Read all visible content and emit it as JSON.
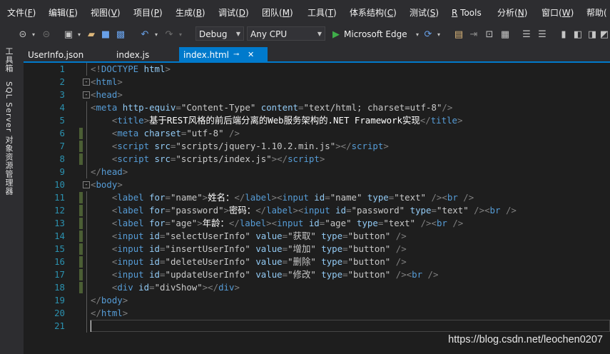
{
  "menu": [
    {
      "label": "文件(",
      "key": "F",
      "tail": ")"
    },
    {
      "label": "编辑(",
      "key": "E",
      "tail": ")"
    },
    {
      "label": "视图(",
      "key": "V",
      "tail": ")"
    },
    {
      "label": "项目(",
      "key": "P",
      "tail": ")"
    },
    {
      "label": "生成(",
      "key": "B",
      "tail": ")"
    },
    {
      "label": "调试(",
      "key": "D",
      "tail": ")"
    },
    {
      "label": "团队(",
      "key": "M",
      "tail": ")"
    },
    {
      "label": "工具(",
      "key": "T",
      "tail": ")"
    },
    {
      "label": "体系结构(",
      "key": "C",
      "tail": ")"
    },
    {
      "label": "测试(",
      "key": "S",
      "tail": ")"
    },
    {
      "label": "",
      "key": "R",
      "tail": " Tools"
    },
    {
      "label": "分析(",
      "key": "N",
      "tail": ")"
    },
    {
      "label": "窗口(",
      "key": "W",
      "tail": ")"
    },
    {
      "label": "帮助(",
      "key": "",
      "tail": ""
    }
  ],
  "toolbar": {
    "config": "Debug",
    "platform": "Any CPU",
    "run_target": "Microsoft Edge"
  },
  "side_tabs": [
    "工具箱",
    "SQL Server 对象资源管理器"
  ],
  "tabs": [
    {
      "label": "UserInfo.json",
      "active": false
    },
    {
      "label": "index.js",
      "active": false
    },
    {
      "label": "index.html",
      "active": true
    }
  ],
  "code_lines": [
    {
      "n": "1",
      "mod": false,
      "fold": "",
      "indent": "",
      "tokens": [
        [
          "b",
          "<!"
        ],
        [
          "t",
          "DOCTYPE"
        ],
        [
          "x",
          " "
        ],
        [
          "a",
          "html"
        ],
        [
          "b",
          ">"
        ]
      ]
    },
    {
      "n": "2",
      "mod": false,
      "fold": "-",
      "indent": "",
      "tokens": [
        [
          "b",
          "<"
        ],
        [
          "t",
          "html"
        ],
        [
          "b",
          ">"
        ]
      ]
    },
    {
      "n": "3",
      "mod": false,
      "fold": "-",
      "indent": "",
      "tokens": [
        [
          "b",
          "<"
        ],
        [
          "t",
          "head"
        ],
        [
          "b",
          ">"
        ]
      ]
    },
    {
      "n": "4",
      "mod": false,
      "fold": "",
      "indent": "",
      "tokens": [
        [
          "b",
          "<"
        ],
        [
          "t",
          "meta"
        ],
        [
          "x",
          " "
        ],
        [
          "a",
          "http-equiv"
        ],
        [
          "b",
          "="
        ],
        [
          "v",
          "\"Content-Type\""
        ],
        [
          "x",
          " "
        ],
        [
          "a",
          "content"
        ],
        [
          "b",
          "="
        ],
        [
          "v",
          "\"text/html; charset=utf-8\""
        ],
        [
          "b",
          "/>"
        ]
      ]
    },
    {
      "n": "5",
      "mod": false,
      "fold": "",
      "indent": "    ",
      "tokens": [
        [
          "b",
          "<"
        ],
        [
          "t",
          "title"
        ],
        [
          "b",
          ">"
        ],
        [
          "x",
          "基于REST风格的前后端分离的Web服务架构的.NET Framework实现"
        ],
        [
          "b",
          "</"
        ],
        [
          "t",
          "title"
        ],
        [
          "b",
          ">"
        ]
      ]
    },
    {
      "n": "6",
      "mod": true,
      "fold": "",
      "indent": "    ",
      "tokens": [
        [
          "b",
          "<"
        ],
        [
          "t",
          "meta"
        ],
        [
          "x",
          " "
        ],
        [
          "a",
          "charset"
        ],
        [
          "b",
          "="
        ],
        [
          "v",
          "\"utf-8\""
        ],
        [
          "x",
          " "
        ],
        [
          "b",
          "/>"
        ]
      ]
    },
    {
      "n": "7",
      "mod": true,
      "fold": "",
      "indent": "    ",
      "tokens": [
        [
          "b",
          "<"
        ],
        [
          "t",
          "script"
        ],
        [
          "x",
          " "
        ],
        [
          "a",
          "src"
        ],
        [
          "b",
          "="
        ],
        [
          "v",
          "\"scripts/jquery-1.10.2.min.js\""
        ],
        [
          "b",
          "></"
        ],
        [
          "t",
          "script"
        ],
        [
          "b",
          ">"
        ]
      ]
    },
    {
      "n": "8",
      "mod": true,
      "fold": "",
      "indent": "    ",
      "tokens": [
        [
          "b",
          "<"
        ],
        [
          "t",
          "script"
        ],
        [
          "x",
          " "
        ],
        [
          "a",
          "src"
        ],
        [
          "b",
          "="
        ],
        [
          "v",
          "\"scripts/index.js\""
        ],
        [
          "b",
          "></"
        ],
        [
          "t",
          "script"
        ],
        [
          "b",
          ">"
        ]
      ]
    },
    {
      "n": "9",
      "mod": false,
      "fold": "",
      "indent": "",
      "tokens": [
        [
          "b",
          "</"
        ],
        [
          "t",
          "head"
        ],
        [
          "b",
          ">"
        ]
      ]
    },
    {
      "n": "10",
      "mod": false,
      "fold": "-",
      "indent": "",
      "tokens": [
        [
          "b",
          "<"
        ],
        [
          "t",
          "body"
        ],
        [
          "b",
          ">"
        ]
      ]
    },
    {
      "n": "11",
      "mod": true,
      "fold": "",
      "indent": "    ",
      "tokens": [
        [
          "b",
          "<"
        ],
        [
          "t",
          "label"
        ],
        [
          "x",
          " "
        ],
        [
          "a",
          "for"
        ],
        [
          "b",
          "="
        ],
        [
          "v",
          "\"name\""
        ],
        [
          "b",
          ">"
        ],
        [
          "x",
          "姓名："
        ],
        [
          "b",
          "</"
        ],
        [
          "t",
          "label"
        ],
        [
          "b",
          "><"
        ],
        [
          "t",
          "input"
        ],
        [
          "x",
          " "
        ],
        [
          "a",
          "id"
        ],
        [
          "b",
          "="
        ],
        [
          "v",
          "\"name\""
        ],
        [
          "x",
          " "
        ],
        [
          "a",
          "type"
        ],
        [
          "b",
          "="
        ],
        [
          "v",
          "\"text\""
        ],
        [
          "x",
          " "
        ],
        [
          "b",
          "/><"
        ],
        [
          "t",
          "br"
        ],
        [
          "b",
          " />"
        ]
      ]
    },
    {
      "n": "12",
      "mod": true,
      "fold": "",
      "indent": "    ",
      "tokens": [
        [
          "b",
          "<"
        ],
        [
          "t",
          "label"
        ],
        [
          "x",
          " "
        ],
        [
          "a",
          "for"
        ],
        [
          "b",
          "="
        ],
        [
          "v",
          "\"password\""
        ],
        [
          "b",
          ">"
        ],
        [
          "x",
          "密码："
        ],
        [
          "b",
          "</"
        ],
        [
          "t",
          "label"
        ],
        [
          "b",
          "><"
        ],
        [
          "t",
          "input"
        ],
        [
          "x",
          " "
        ],
        [
          "a",
          "id"
        ],
        [
          "b",
          "="
        ],
        [
          "v",
          "\"password\""
        ],
        [
          "x",
          " "
        ],
        [
          "a",
          "type"
        ],
        [
          "b",
          "="
        ],
        [
          "v",
          "\"text\""
        ],
        [
          "x",
          " "
        ],
        [
          "b",
          "/><"
        ],
        [
          "t",
          "br"
        ],
        [
          "x",
          " "
        ],
        [
          "b",
          "/>"
        ]
      ]
    },
    {
      "n": "13",
      "mod": true,
      "fold": "",
      "indent": "    ",
      "tokens": [
        [
          "b",
          "<"
        ],
        [
          "t",
          "label"
        ],
        [
          "x",
          " "
        ],
        [
          "a",
          "for"
        ],
        [
          "b",
          "="
        ],
        [
          "v",
          "\"age\""
        ],
        [
          "b",
          ">"
        ],
        [
          "x",
          "年龄："
        ],
        [
          "b",
          "</"
        ],
        [
          "t",
          "label"
        ],
        [
          "b",
          "><"
        ],
        [
          "t",
          "input"
        ],
        [
          "x",
          " "
        ],
        [
          "a",
          "id"
        ],
        [
          "b",
          "="
        ],
        [
          "v",
          "\"age\""
        ],
        [
          "x",
          " "
        ],
        [
          "a",
          "type"
        ],
        [
          "b",
          "="
        ],
        [
          "v",
          "\"text\""
        ],
        [
          "x",
          " "
        ],
        [
          "b",
          "/><"
        ],
        [
          "t",
          "br"
        ],
        [
          "x",
          " "
        ],
        [
          "b",
          "/>"
        ]
      ]
    },
    {
      "n": "14",
      "mod": true,
      "fold": "",
      "indent": "    ",
      "tokens": [
        [
          "b",
          "<"
        ],
        [
          "t",
          "input"
        ],
        [
          "x",
          " "
        ],
        [
          "a",
          "id"
        ],
        [
          "b",
          "="
        ],
        [
          "v",
          "\"selectUserInfo\""
        ],
        [
          "x",
          " "
        ],
        [
          "a",
          "value"
        ],
        [
          "b",
          "="
        ],
        [
          "v",
          "\"获取\""
        ],
        [
          "x",
          " "
        ],
        [
          "a",
          "type"
        ],
        [
          "b",
          "="
        ],
        [
          "v",
          "\"button\""
        ],
        [
          "x",
          " "
        ],
        [
          "b",
          "/>"
        ]
      ]
    },
    {
      "n": "15",
      "mod": true,
      "fold": "",
      "indent": "    ",
      "tokens": [
        [
          "b",
          "<"
        ],
        [
          "t",
          "input"
        ],
        [
          "x",
          " "
        ],
        [
          "a",
          "id"
        ],
        [
          "b",
          "="
        ],
        [
          "v",
          "\"insertUserInfo\""
        ],
        [
          "x",
          " "
        ],
        [
          "a",
          "value"
        ],
        [
          "b",
          "="
        ],
        [
          "v",
          "\"增加\""
        ],
        [
          "x",
          " "
        ],
        [
          "a",
          "type"
        ],
        [
          "b",
          "="
        ],
        [
          "v",
          "\"button\""
        ],
        [
          "x",
          " "
        ],
        [
          "b",
          "/>"
        ]
      ]
    },
    {
      "n": "16",
      "mod": true,
      "fold": "",
      "indent": "    ",
      "tokens": [
        [
          "b",
          "<"
        ],
        [
          "t",
          "input"
        ],
        [
          "x",
          " "
        ],
        [
          "a",
          "id"
        ],
        [
          "b",
          "="
        ],
        [
          "v",
          "\"deleteUserInfo\""
        ],
        [
          "x",
          " "
        ],
        [
          "a",
          "value"
        ],
        [
          "b",
          "="
        ],
        [
          "v",
          "\"删除\""
        ],
        [
          "x",
          " "
        ],
        [
          "a",
          "type"
        ],
        [
          "b",
          "="
        ],
        [
          "v",
          "\"button\""
        ],
        [
          "x",
          " "
        ],
        [
          "b",
          "/>"
        ]
      ]
    },
    {
      "n": "17",
      "mod": true,
      "fold": "",
      "indent": "    ",
      "tokens": [
        [
          "b",
          "<"
        ],
        [
          "t",
          "input"
        ],
        [
          "x",
          " "
        ],
        [
          "a",
          "id"
        ],
        [
          "b",
          "="
        ],
        [
          "v",
          "\"updateUserInfo\""
        ],
        [
          "x",
          " "
        ],
        [
          "a",
          "value"
        ],
        [
          "b",
          "="
        ],
        [
          "v",
          "\"修改\""
        ],
        [
          "x",
          " "
        ],
        [
          "a",
          "type"
        ],
        [
          "b",
          "="
        ],
        [
          "v",
          "\"button\""
        ],
        [
          "x",
          " "
        ],
        [
          "b",
          "/><"
        ],
        [
          "t",
          "br"
        ],
        [
          "x",
          " "
        ],
        [
          "b",
          "/>"
        ]
      ]
    },
    {
      "n": "18",
      "mod": true,
      "fold": "",
      "indent": "    ",
      "tokens": [
        [
          "b",
          "<"
        ],
        [
          "t",
          "div"
        ],
        [
          "x",
          " "
        ],
        [
          "a",
          "id"
        ],
        [
          "b",
          "="
        ],
        [
          "v",
          "\"divShow\""
        ],
        [
          "b",
          "></"
        ],
        [
          "t",
          "div"
        ],
        [
          "b",
          ">"
        ]
      ]
    },
    {
      "n": "19",
      "mod": false,
      "fold": "",
      "indent": "",
      "tokens": [
        [
          "b",
          "</"
        ],
        [
          "t",
          "body"
        ],
        [
          "b",
          ">"
        ]
      ]
    },
    {
      "n": "20",
      "mod": false,
      "fold": "",
      "indent": "",
      "tokens": [
        [
          "b",
          "</"
        ],
        [
          "t",
          "html"
        ],
        [
          "b",
          ">"
        ]
      ]
    },
    {
      "n": "21",
      "mod": false,
      "fold": "",
      "indent": "",
      "tokens": []
    }
  ],
  "watermark": "https://blog.csdn.net/leochen0207"
}
